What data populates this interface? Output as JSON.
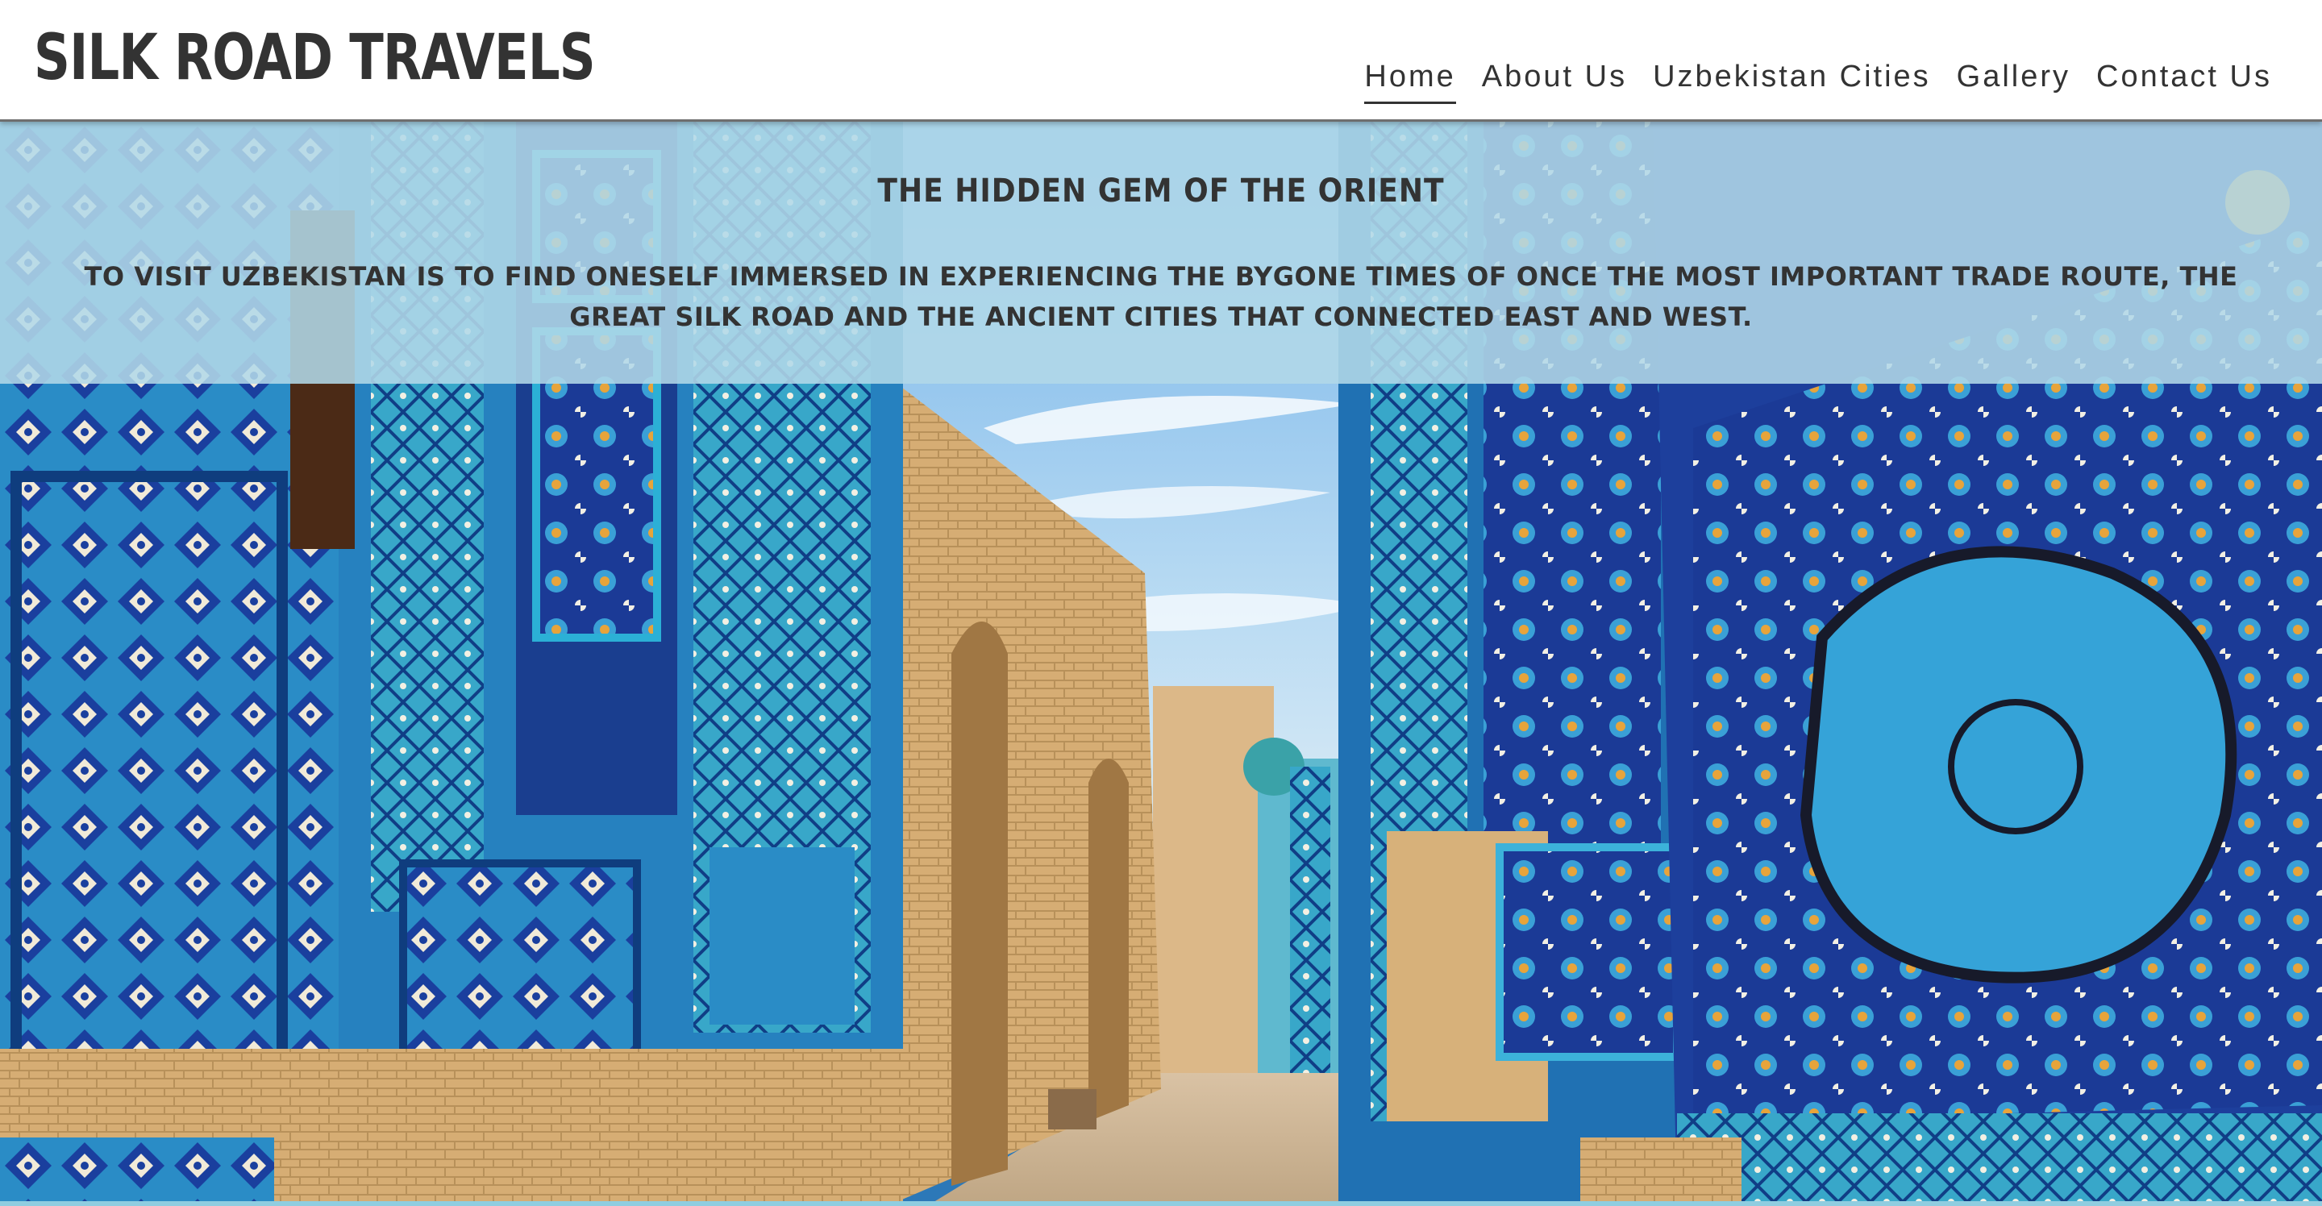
{
  "site": {
    "brand": "SILK ROAD TRAVELS"
  },
  "nav": {
    "items": [
      {
        "label": "Home",
        "active": true
      },
      {
        "label": "About Us",
        "active": false
      },
      {
        "label": "Uzbekistan Cities",
        "active": false
      },
      {
        "label": "Gallery",
        "active": false
      },
      {
        "label": "Contact Us",
        "active": false
      }
    ]
  },
  "hero": {
    "title": "THE HIDDEN GEM OF THE ORIENT",
    "text": "TO VISIT UZBEKISTAN IS TO FIND ONESELF IMMERSED IN EXPERIENCING THE BYGONE TIMES OF ONCE THE MOST IMPORTANT TRADE ROUTE, THE GREAT SILK ROAD AND THE ANCIENT CITIES THAT CONNECTED EAST AND WEST.",
    "image": "Shah-i-Zinda necropolis street with blue tiled mausoleums",
    "banner_color": "#b2d8e8"
  },
  "colors": {
    "text": "#333333",
    "tile_blue": "#1f7fbf",
    "tile_cobalt": "#1b3d9a",
    "brick": "#d8b27a",
    "sky": "#9fcbef"
  }
}
